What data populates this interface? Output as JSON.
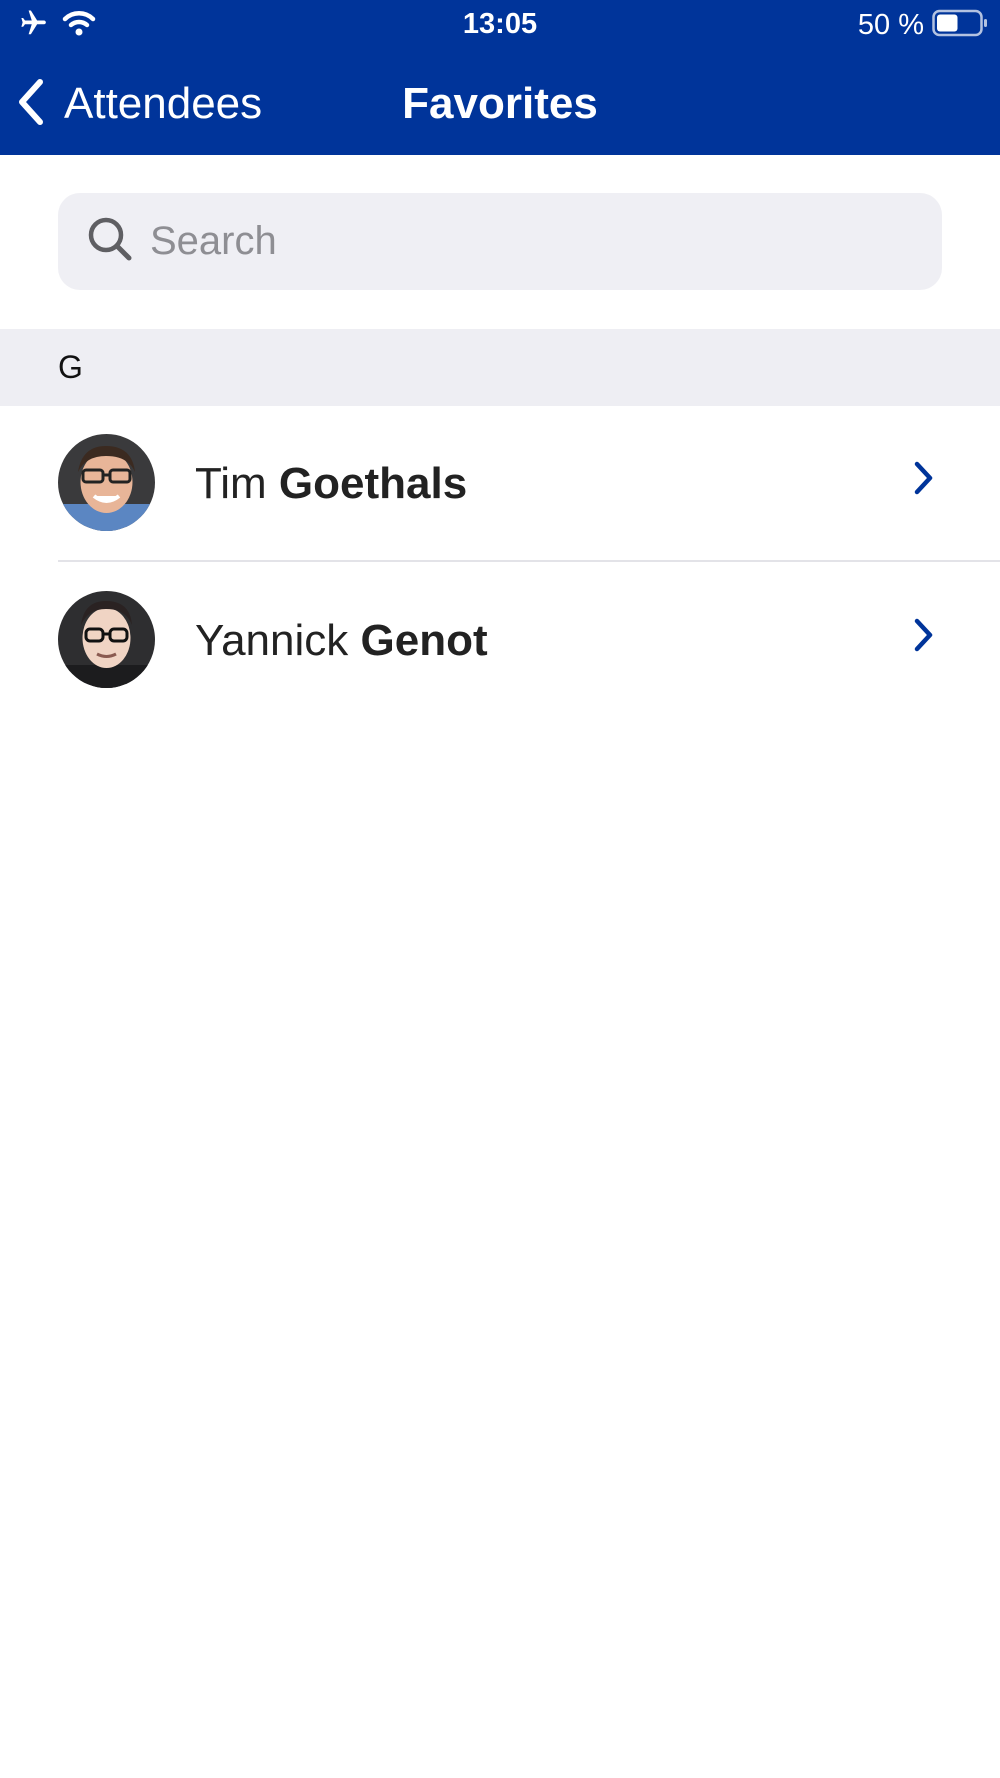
{
  "status_bar": {
    "time": "13:05",
    "battery_percent": "50 %",
    "battery_level": 0.5,
    "icons": [
      "airplane-icon",
      "wifi-icon",
      "battery-icon"
    ]
  },
  "nav": {
    "back_label": "Attendees",
    "title": "Favorites"
  },
  "search": {
    "placeholder": "Search",
    "value": ""
  },
  "sections": [
    {
      "letter": "G",
      "items": [
        {
          "first_name": "Tim",
          "last_name": "Goethals",
          "avatar": "person-photo"
        },
        {
          "first_name": "Yannick",
          "last_name": "Genot",
          "avatar": "person-photo"
        }
      ]
    }
  ],
  "colors": {
    "header_bg": "#00349A",
    "accent": "#00349A",
    "search_bg": "#EFEFF4",
    "section_bg": "#EEEEF3"
  }
}
